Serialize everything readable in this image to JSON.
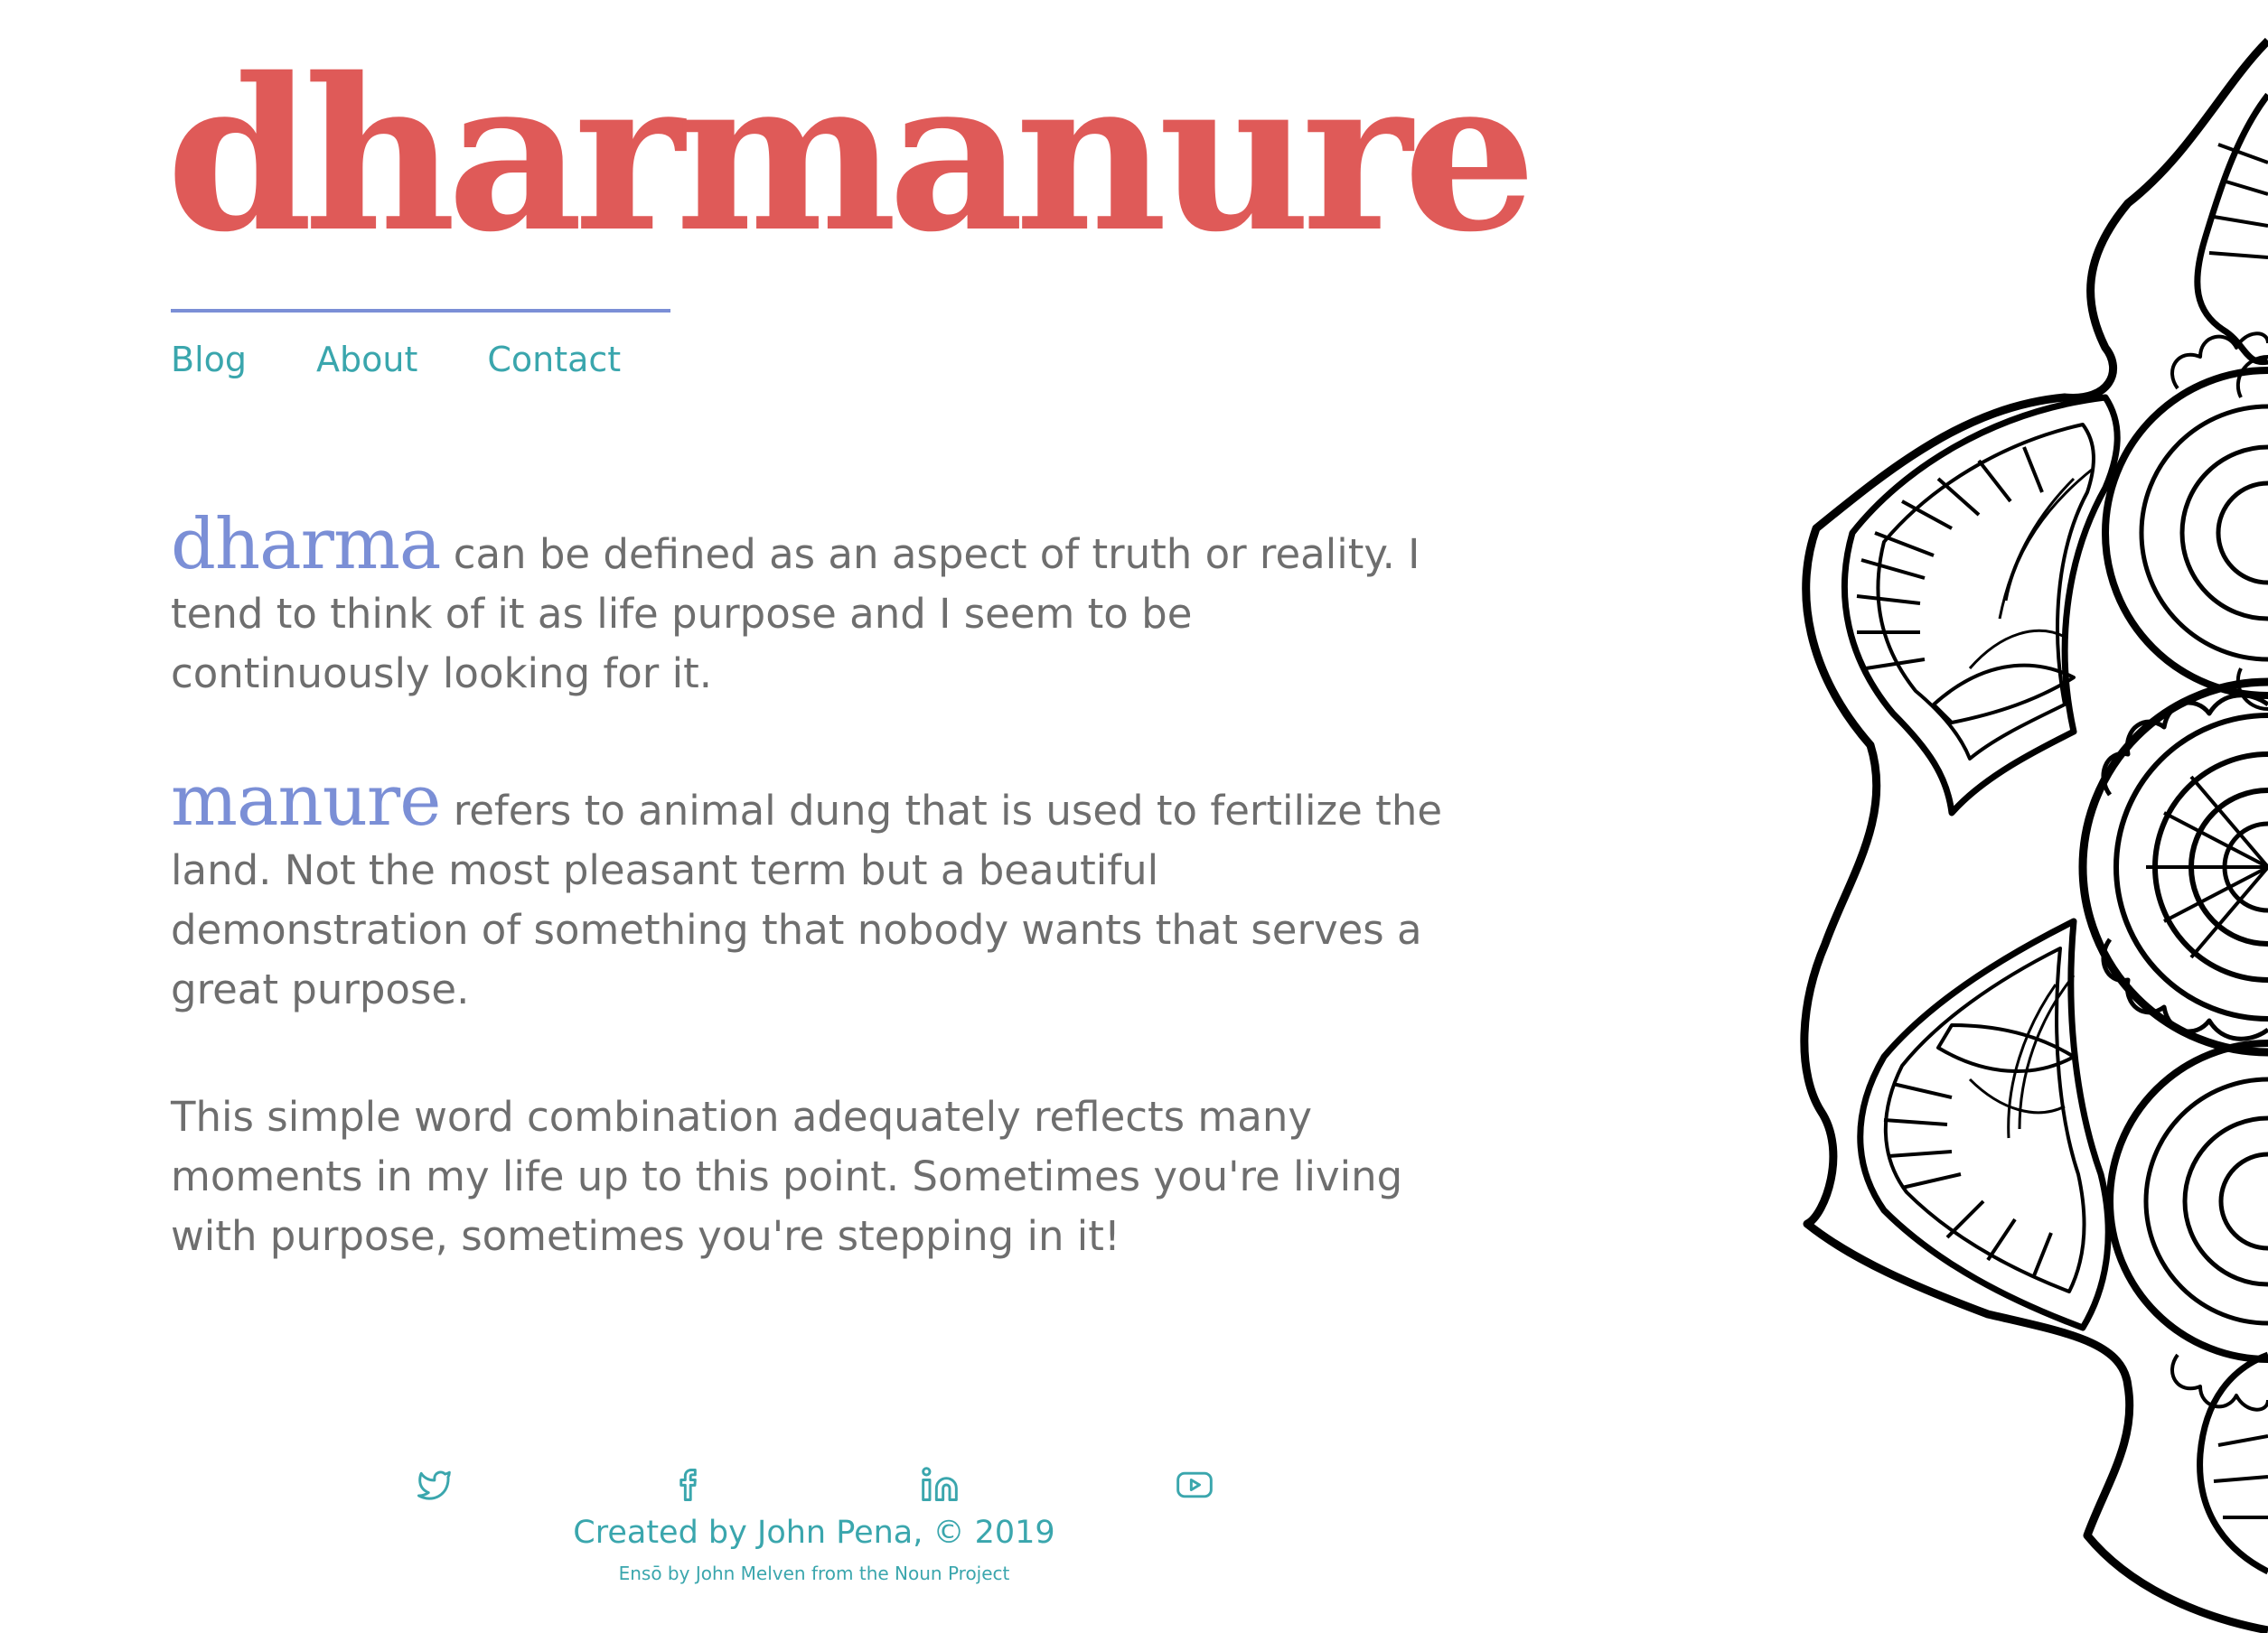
{
  "site": {
    "title": "dharmanure"
  },
  "nav": {
    "items": [
      {
        "label": "Blog"
      },
      {
        "label": "About"
      },
      {
        "label": "Contact"
      }
    ]
  },
  "content": {
    "p1": {
      "term": "dharma",
      "text": " can be defined as an aspect of truth or reality. I tend to think of it as life purpose and I seem to be continuously looking for it."
    },
    "p2": {
      "term": "manure",
      "text": " refers to animal dung that is used to fertilize the land. Not the most pleasant term but a beautiful demonstration of something that nobody wants that serves a great purpose."
    },
    "p3": {
      "text": "This simple word combination adequately reflects many moments in my life up to this point. Sometimes you're living with purpose, sometimes you're stepping in it!"
    }
  },
  "footer": {
    "social_icons": [
      "twitter-icon",
      "facebook-icon",
      "linkedin-icon",
      "youtube-icon"
    ],
    "credit": "Created by John Pena, © 2019",
    "attribution": "Ensō by John Melven from the Noun Project"
  },
  "colors": {
    "title": "#df5a58",
    "accent": "#7b8fd6",
    "link": "#3aa6ad",
    "body_text": "#6e6e6e"
  }
}
